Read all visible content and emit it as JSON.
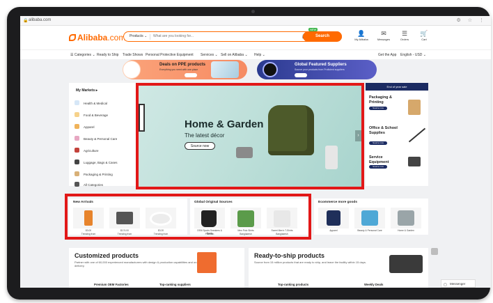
{
  "browser": {
    "url": "alibaba.com",
    "icons": "⚙ ☆ ⋮"
  },
  "header": {
    "logo": "Alibaba",
    "logo_suffix": ".com",
    "search_category": "Products ⌄",
    "search_placeholder": "What are you looking for...",
    "search_button": "Search",
    "new_tag": "NEW",
    "icons": [
      {
        "label": "My Alibaba"
      },
      {
        "label": "Messages"
      },
      {
        "label": "Orders"
      },
      {
        "label": "Cart"
      }
    ]
  },
  "nav": {
    "categories": "☰ Categories ⌄",
    "items": [
      "Ready to Ship",
      "Trade Shows",
      "Personal Protective Equipment",
      "Services ⌄",
      "Sell on Alibaba ⌄",
      "Help ⌄"
    ],
    "right": [
      "Get the App",
      "English - USD ⌄"
    ]
  },
  "promos": [
    {
      "title": "Deals on PPE products",
      "subtitle": "Everything you need with one place"
    },
    {
      "title": "Global Featured Suppliers",
      "subtitle": "Source your products from Proficient suppliers"
    }
  ],
  "categories": {
    "title": "My Markets ▸",
    "items": [
      {
        "label": "Health & Medical",
        "color": "#d6e7f7"
      },
      {
        "label": "Food & Beverage",
        "color": "#f6d28b"
      },
      {
        "label": "Apparel",
        "color": "#f0b35a"
      },
      {
        "label": "Beauty & Personal Care",
        "color": "#e7a7c2"
      },
      {
        "label": "Agriculture",
        "color": "#c3423b"
      },
      {
        "label": "Luggage, Bags & Cases",
        "color": "#444444"
      },
      {
        "label": "Packaging & Printing",
        "color": "#d8b077"
      },
      {
        "label": "All Categories",
        "color": "#555555"
      }
    ]
  },
  "hero": {
    "title": "Home & Garden",
    "subtitle": "The latest décor",
    "button": "Source now"
  },
  "right_panel": {
    "header": "End of year sale",
    "items": [
      {
        "title": "Packaging & Printing",
        "button": "Source now"
      },
      {
        "title": "Office & School Supplies",
        "button": "Source now"
      },
      {
        "title": "Service Equipment",
        "button": "Source now"
      }
    ]
  },
  "new_arrivals": {
    "title": "New Arrivals",
    "products": [
      {
        "price": "$3.00",
        "label": "Trending from"
      },
      {
        "price": "$174.00",
        "label": "Trending from"
      },
      {
        "price": "$3.20",
        "label": "Trending from"
      }
    ]
  },
  "global_courses": {
    "title": "Global Original Sources",
    "products": [
      {
        "name": "OEM Sports Sneakers & Boots",
        "origin": "Pakistan"
      },
      {
        "name": "Men Polo Shirts",
        "origin": "Bangladesh"
      },
      {
        "name": "Sweet Men's T-Shirts",
        "origin": "Bangladesh"
      }
    ]
  },
  "ecommerce": {
    "title": "Ecommerce more goods",
    "products": [
      {
        "name": "Apparel"
      },
      {
        "name": "Beauty & Personal Care"
      },
      {
        "name": "Home & Garden"
      }
    ]
  },
  "customized": {
    "title": "Customized products",
    "desc": "Partner with one of 60,000 experienced manufacturers with design & production capabilities and on-time delivery.",
    "links": [
      "Premium OEM Factories",
      "Top-ranking suppliers"
    ]
  },
  "ready": {
    "title": "Ready-to-ship products",
    "desc": "Source from 15 million products that are ready to ship, and leave the facility within 15 days.",
    "links": [
      "Top-ranking products",
      "Weekly Deals"
    ]
  },
  "messenger": "Messenger"
}
